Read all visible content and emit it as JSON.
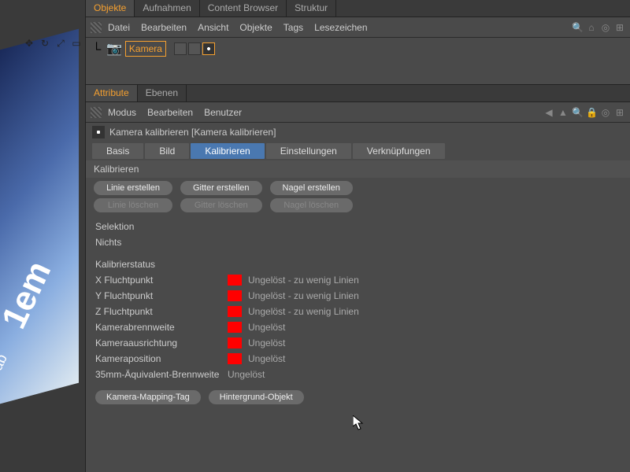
{
  "topTabs": {
    "objekte": "Objekte",
    "aufnahmen": "Aufnahmen",
    "content": "Content Browser",
    "struktur": "Struktur"
  },
  "objMenu": {
    "datei": "Datei",
    "bearbeiten": "Bearbeiten",
    "ansicht": "Ansicht",
    "objekte": "Objekte",
    "tags": "Tags",
    "lesezeichen": "Lesezeichen"
  },
  "objectName": "Kamera",
  "attrTabs": {
    "attribute": "Attribute",
    "ebenen": "Ebenen"
  },
  "attrMenu": {
    "modus": "Modus",
    "bearbeiten": "Bearbeiten",
    "benutzer": "Benutzer"
  },
  "titleText": "Kamera kalibrieren [Kamera kalibrieren]",
  "subTabs": {
    "basis": "Basis",
    "bild": "Bild",
    "kalibrieren": "Kalibrieren",
    "einstellungen": "Einstellungen",
    "verkn": "Verknüpfungen"
  },
  "sectionHeader": "Kalibrieren",
  "createButtons": {
    "linieErstellen": "Linie erstellen",
    "linieLoeschen": "Linie löschen",
    "gitterErstellen": "Gitter erstellen",
    "gitterLoeschen": "Gitter löschen",
    "nagelErstellen": "Nagel erstellen",
    "nagelLoeschen": "Nagel löschen"
  },
  "selection": {
    "label": "Selektion",
    "value": "Nichts"
  },
  "statusHeader": "Kalibrierstatus",
  "statusRows": [
    {
      "label": "X Fluchtpunkt",
      "swatch": true,
      "value": "Ungelöst - zu wenig Linien"
    },
    {
      "label": "Y Fluchtpunkt",
      "swatch": true,
      "value": "Ungelöst - zu wenig Linien"
    },
    {
      "label": "Z Fluchtpunkt",
      "swatch": true,
      "value": "Ungelöst - zu wenig Linien"
    },
    {
      "label": "Kamerabrennweite",
      "swatch": true,
      "value": "Ungelöst"
    },
    {
      "label": "Kameraausrichtung",
      "swatch": true,
      "value": "Ungelöst"
    },
    {
      "label": "Kameraposition",
      "swatch": true,
      "value": "Ungelöst"
    },
    {
      "label": "35mm-Äquivalent-Brennweite",
      "swatch": false,
      "value": "Ungelöst"
    }
  ],
  "bottomButtons": {
    "mapping": "Kamera-Mapping-Tag",
    "hintergrund": "Hintergrund-Objekt"
  },
  "colors": {
    "swatch": "#ff0000",
    "accent": "#f5a030",
    "activeTab": "#4a78b0"
  }
}
